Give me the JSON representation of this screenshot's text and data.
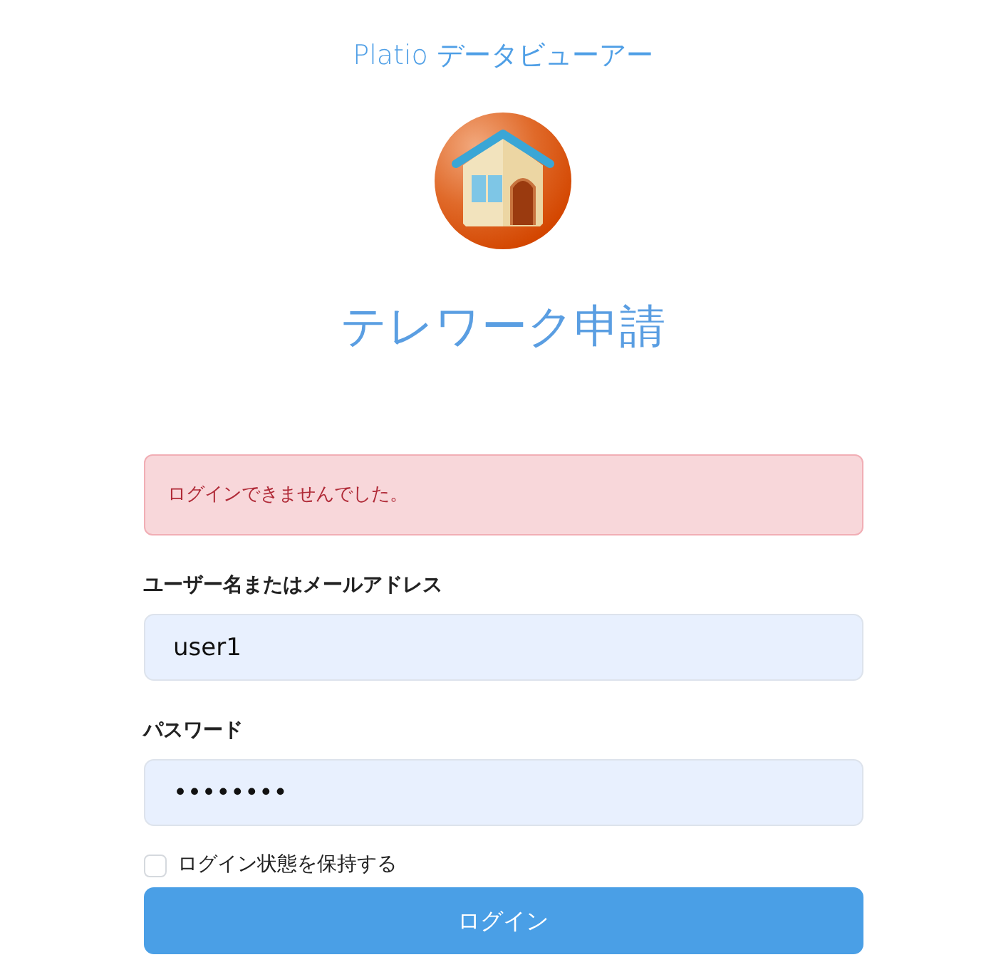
{
  "app_title": "Platio データビューアー",
  "heading": "テレワーク申請",
  "alert": {
    "kind": "danger",
    "message": "ログインできませんでした。"
  },
  "fields": [
    {
      "label": "ユーザー名またはメールアドレス",
      "value": "user1"
    },
    {
      "label": "パスワード",
      "value": "••••••••"
    }
  ],
  "remember": {
    "label": "ログイン状態を保持する",
    "checked": false
  },
  "login_button": {
    "label": "ログイン"
  }
}
